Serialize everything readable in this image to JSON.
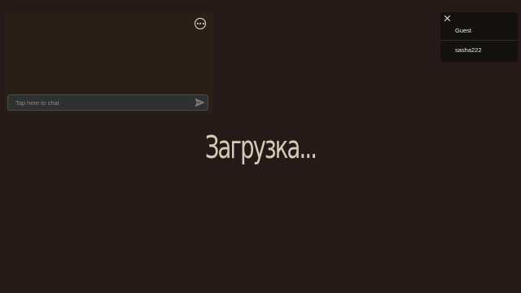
{
  "chat": {
    "placeholder": "Tap here to chat",
    "more_icon": "more-horizontal-circle-icon",
    "send_icon": "send-icon"
  },
  "loading": {
    "text": "Загрузка..."
  },
  "players": {
    "close_icon": "close-icon",
    "items": [
      {
        "name": "Guest"
      },
      {
        "name": "sasha222"
      }
    ]
  },
  "colors": {
    "background": "#261a19",
    "chat_panel": "#2a1f17",
    "input_bg": "#2f3030",
    "loading_text": "#d6ccb5",
    "player_panel": "#141211"
  }
}
